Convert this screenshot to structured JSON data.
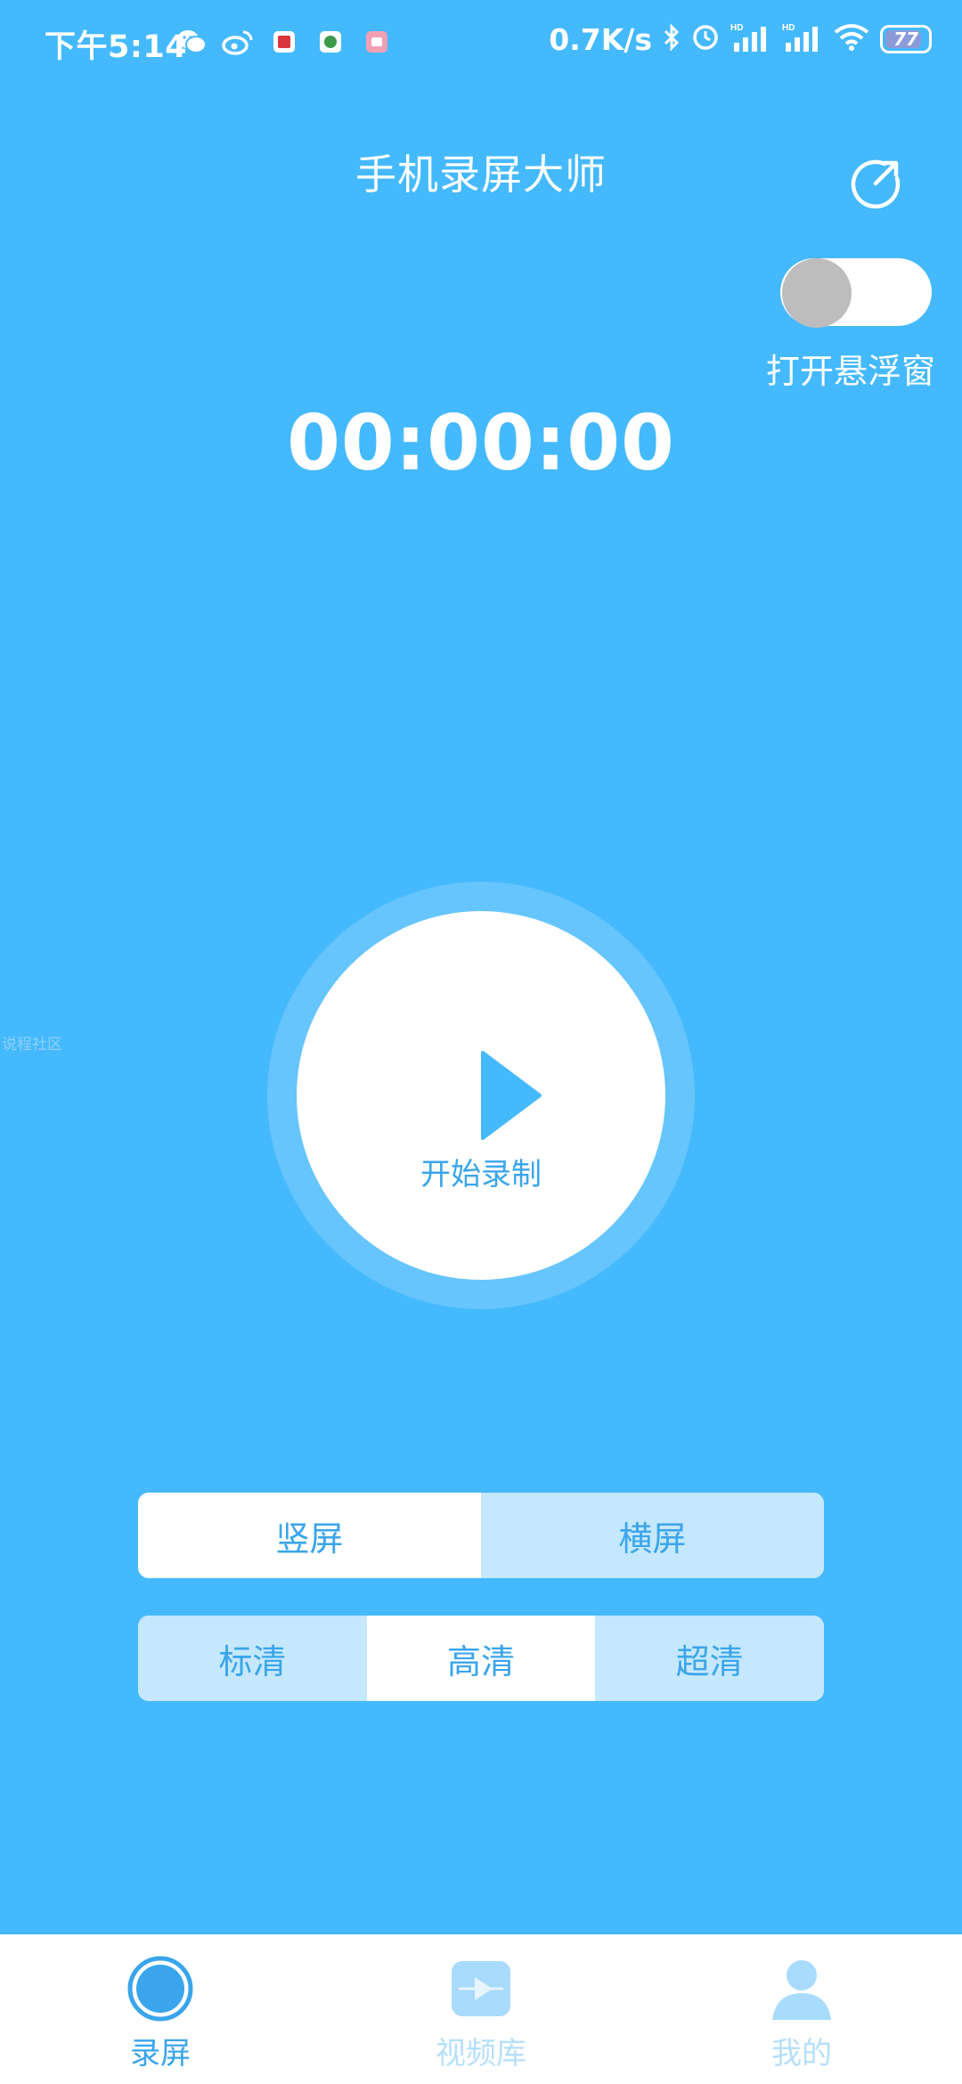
{
  "status_bar": {
    "time": "下午5:14",
    "network_speed": "0.7K/s",
    "battery_level": "77",
    "notification_icons": [
      "wechat-icon",
      "weibo-icon",
      "red-app-icon",
      "green-app-icon",
      "pink-app-icon"
    ],
    "system_icons": [
      "bluetooth-icon",
      "alarm-icon",
      "signal-hd-icon",
      "signal-hd-icon",
      "wifi-icon",
      "battery-icon"
    ]
  },
  "header": {
    "title": "手机录屏大师",
    "refresh_icon": "refresh-icon"
  },
  "floating_window": {
    "label": "打开悬浮窗",
    "enabled": false
  },
  "timer": "00:00:00",
  "watermark": "说程社区",
  "record": {
    "label": "开始录制",
    "icon": "play-icon"
  },
  "orientation": {
    "options": [
      "竖屏",
      "横屏"
    ],
    "selected": "竖屏"
  },
  "quality": {
    "options": [
      "标清",
      "高清",
      "超清"
    ],
    "selected": "高清"
  },
  "bottom_nav": {
    "items": [
      {
        "label": "录屏",
        "icon": "record-ring-icon",
        "active": true
      },
      {
        "label": "视频库",
        "icon": "video-library-icon",
        "active": false
      },
      {
        "label": "我的",
        "icon": "profile-icon",
        "active": false
      }
    ]
  },
  "colors": {
    "background": "#45B9FD",
    "accent": "#3AA5EC",
    "segment_inactive": "#C5E8FE",
    "toggle_knob_off": "#BDBDBD"
  }
}
